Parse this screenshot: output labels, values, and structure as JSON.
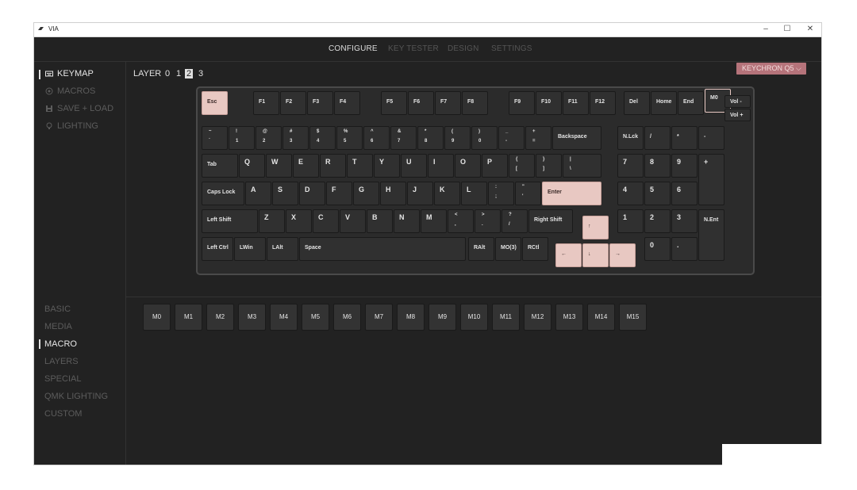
{
  "app": {
    "title": "VIA"
  },
  "window_controls": {
    "minimize": "–",
    "maximize": "☐",
    "close": "✕"
  },
  "nav": {
    "tabs": [
      "CONFIGURE",
      "KEY TESTER",
      "DESIGN",
      "SETTINGS"
    ],
    "active": "CONFIGURE"
  },
  "sidebar": {
    "items": [
      {
        "label": "KEYMAP",
        "icon": "keyboard-icon",
        "active": true
      },
      {
        "label": "MACROS",
        "icon": "macro-circle-icon",
        "active": false
      },
      {
        "label": "SAVE + LOAD",
        "icon": "save-icon",
        "active": false
      },
      {
        "label": "LIGHTING",
        "icon": "lightbulb-icon",
        "active": false
      }
    ]
  },
  "layers": {
    "label": "LAYER",
    "options": [
      "0",
      "1",
      "2",
      "3"
    ],
    "selected": "2"
  },
  "keyboard_select": {
    "label": "KEYCHRON Q5"
  },
  "keys": {
    "esc": "Esc",
    "f1": "F1",
    "f2": "F2",
    "f3": "F3",
    "f4": "F4",
    "f5": "F5",
    "f6": "F6",
    "f7": "F7",
    "f8": "F8",
    "f9": "F9",
    "f10": "F10",
    "f11": "F11",
    "f12": "F12",
    "del": "Del",
    "home": "Home",
    "end": "End",
    "m0": "M0",
    "vol_down": "Vol -",
    "vol_up": "Vol +",
    "grave_top": "~",
    "grave_bot": "`",
    "n1_top": "!",
    "n1_bot": "1",
    "n2_top": "@",
    "n2_bot": "2",
    "n3_top": "#",
    "n3_bot": "3",
    "n4_top": "$",
    "n4_bot": "4",
    "n5_top": "%",
    "n5_bot": "5",
    "n6_top": "^",
    "n6_bot": "6",
    "n7_top": "&",
    "n7_bot": "7",
    "n8_top": "*",
    "n8_bot": "8",
    "n9_top": "(",
    "n9_bot": "9",
    "n0_top": ")",
    "n0_bot": "0",
    "minus_top": "_",
    "minus_bot": "-",
    "eq_top": "+",
    "eq_bot": "=",
    "backspace": "Backspace",
    "nlck": "N.Lck",
    "np_slash": "/",
    "np_star": "*",
    "np_minus": "-",
    "tab": "Tab",
    "q": "Q",
    "w": "W",
    "e": "E",
    "r": "R",
    "t": "T",
    "y": "Y",
    "u": "U",
    "i": "I",
    "o": "O",
    "p": "P",
    "lbr_top": "{",
    "lbr_bot": "[",
    "rbr_top": "}",
    "rbr_bot": "]",
    "bsl_top": "|",
    "bsl_bot": "\\",
    "np7": "7",
    "np8": "8",
    "np9": "9",
    "np_plus": "+",
    "caps": "Caps Lock",
    "a": "A",
    "s": "S",
    "d": "D",
    "f": "F",
    "g": "G",
    "h": "H",
    "j": "J",
    "k": "K",
    "l": "L",
    "semi_top": ":",
    "semi_bot": ";",
    "quote_top": "\"",
    "quote_bot": "'",
    "enter": "Enter",
    "np4": "4",
    "np5": "5",
    "np6": "6",
    "lshift": "Left Shift",
    "z": "Z",
    "x": "X",
    "c": "C",
    "v": "V",
    "b": "B",
    "n": "N",
    "m": "M",
    "comma_top": "<",
    "comma_bot": ",",
    "dot_top": ">",
    "dot_bot": ".",
    "slash_top": "?",
    "slash_bot": "/",
    "rshift": "Right Shift",
    "up": "↑",
    "np1": "1",
    "np2": "2",
    "np3": "3",
    "nent": "N.Ent",
    "lctrl": "Left Ctrl",
    "lwin": "LWin",
    "lalt": "LAlt",
    "space": "Space",
    "ralt": "RAlt",
    "mo3": "MO(3)",
    "rctl": "RCtl",
    "left": "←",
    "down": "↓",
    "right": "→",
    "np0": "0",
    "np_dot": "."
  },
  "categories": {
    "items": [
      "BASIC",
      "MEDIA",
      "MACRO",
      "LAYERS",
      "SPECIAL",
      "QMK LIGHTING",
      "CUSTOM"
    ],
    "active": "MACRO"
  },
  "macro_keys": [
    "M0",
    "M1",
    "M2",
    "M3",
    "M4",
    "M5",
    "M6",
    "M7",
    "M8",
    "M9",
    "M10",
    "M11",
    "M12",
    "M13",
    "M14",
    "M15"
  ],
  "colors": {
    "accent": "#e8c8c2",
    "badge": "#b5737a",
    "background": "#222222"
  }
}
